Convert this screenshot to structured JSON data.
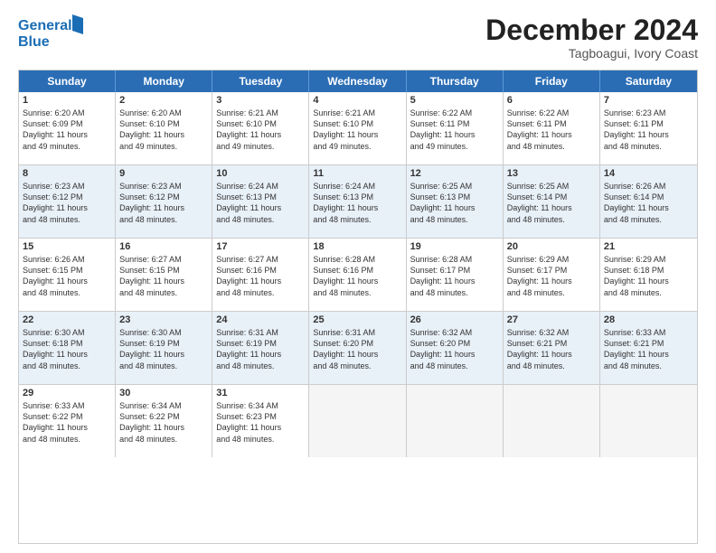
{
  "header": {
    "logo_line1": "General",
    "logo_line2": "Blue",
    "month_title": "December 2024",
    "location": "Tagboagui, Ivory Coast"
  },
  "weekdays": [
    "Sunday",
    "Monday",
    "Tuesday",
    "Wednesday",
    "Thursday",
    "Friday",
    "Saturday"
  ],
  "rows": [
    [
      {
        "day": "1",
        "lines": [
          "Sunrise: 6:20 AM",
          "Sunset: 6:09 PM",
          "Daylight: 11 hours",
          "and 49 minutes."
        ]
      },
      {
        "day": "2",
        "lines": [
          "Sunrise: 6:20 AM",
          "Sunset: 6:10 PM",
          "Daylight: 11 hours",
          "and 49 minutes."
        ]
      },
      {
        "day": "3",
        "lines": [
          "Sunrise: 6:21 AM",
          "Sunset: 6:10 PM",
          "Daylight: 11 hours",
          "and 49 minutes."
        ]
      },
      {
        "day": "4",
        "lines": [
          "Sunrise: 6:21 AM",
          "Sunset: 6:10 PM",
          "Daylight: 11 hours",
          "and 49 minutes."
        ]
      },
      {
        "day": "5",
        "lines": [
          "Sunrise: 6:22 AM",
          "Sunset: 6:11 PM",
          "Daylight: 11 hours",
          "and 49 minutes."
        ]
      },
      {
        "day": "6",
        "lines": [
          "Sunrise: 6:22 AM",
          "Sunset: 6:11 PM",
          "Daylight: 11 hours",
          "and 48 minutes."
        ]
      },
      {
        "day": "7",
        "lines": [
          "Sunrise: 6:23 AM",
          "Sunset: 6:11 PM",
          "Daylight: 11 hours",
          "and 48 minutes."
        ]
      }
    ],
    [
      {
        "day": "8",
        "lines": [
          "Sunrise: 6:23 AM",
          "Sunset: 6:12 PM",
          "Daylight: 11 hours",
          "and 48 minutes."
        ]
      },
      {
        "day": "9",
        "lines": [
          "Sunrise: 6:23 AM",
          "Sunset: 6:12 PM",
          "Daylight: 11 hours",
          "and 48 minutes."
        ]
      },
      {
        "day": "10",
        "lines": [
          "Sunrise: 6:24 AM",
          "Sunset: 6:13 PM",
          "Daylight: 11 hours",
          "and 48 minutes."
        ]
      },
      {
        "day": "11",
        "lines": [
          "Sunrise: 6:24 AM",
          "Sunset: 6:13 PM",
          "Daylight: 11 hours",
          "and 48 minutes."
        ]
      },
      {
        "day": "12",
        "lines": [
          "Sunrise: 6:25 AM",
          "Sunset: 6:13 PM",
          "Daylight: 11 hours",
          "and 48 minutes."
        ]
      },
      {
        "day": "13",
        "lines": [
          "Sunrise: 6:25 AM",
          "Sunset: 6:14 PM",
          "Daylight: 11 hours",
          "and 48 minutes."
        ]
      },
      {
        "day": "14",
        "lines": [
          "Sunrise: 6:26 AM",
          "Sunset: 6:14 PM",
          "Daylight: 11 hours",
          "and 48 minutes."
        ]
      }
    ],
    [
      {
        "day": "15",
        "lines": [
          "Sunrise: 6:26 AM",
          "Sunset: 6:15 PM",
          "Daylight: 11 hours",
          "and 48 minutes."
        ]
      },
      {
        "day": "16",
        "lines": [
          "Sunrise: 6:27 AM",
          "Sunset: 6:15 PM",
          "Daylight: 11 hours",
          "and 48 minutes."
        ]
      },
      {
        "day": "17",
        "lines": [
          "Sunrise: 6:27 AM",
          "Sunset: 6:16 PM",
          "Daylight: 11 hours",
          "and 48 minutes."
        ]
      },
      {
        "day": "18",
        "lines": [
          "Sunrise: 6:28 AM",
          "Sunset: 6:16 PM",
          "Daylight: 11 hours",
          "and 48 minutes."
        ]
      },
      {
        "day": "19",
        "lines": [
          "Sunrise: 6:28 AM",
          "Sunset: 6:17 PM",
          "Daylight: 11 hours",
          "and 48 minutes."
        ]
      },
      {
        "day": "20",
        "lines": [
          "Sunrise: 6:29 AM",
          "Sunset: 6:17 PM",
          "Daylight: 11 hours",
          "and 48 minutes."
        ]
      },
      {
        "day": "21",
        "lines": [
          "Sunrise: 6:29 AM",
          "Sunset: 6:18 PM",
          "Daylight: 11 hours",
          "and 48 minutes."
        ]
      }
    ],
    [
      {
        "day": "22",
        "lines": [
          "Sunrise: 6:30 AM",
          "Sunset: 6:18 PM",
          "Daylight: 11 hours",
          "and 48 minutes."
        ]
      },
      {
        "day": "23",
        "lines": [
          "Sunrise: 6:30 AM",
          "Sunset: 6:19 PM",
          "Daylight: 11 hours",
          "and 48 minutes."
        ]
      },
      {
        "day": "24",
        "lines": [
          "Sunrise: 6:31 AM",
          "Sunset: 6:19 PM",
          "Daylight: 11 hours",
          "and 48 minutes."
        ]
      },
      {
        "day": "25",
        "lines": [
          "Sunrise: 6:31 AM",
          "Sunset: 6:20 PM",
          "Daylight: 11 hours",
          "and 48 minutes."
        ]
      },
      {
        "day": "26",
        "lines": [
          "Sunrise: 6:32 AM",
          "Sunset: 6:20 PM",
          "Daylight: 11 hours",
          "and 48 minutes."
        ]
      },
      {
        "day": "27",
        "lines": [
          "Sunrise: 6:32 AM",
          "Sunset: 6:21 PM",
          "Daylight: 11 hours",
          "and 48 minutes."
        ]
      },
      {
        "day": "28",
        "lines": [
          "Sunrise: 6:33 AM",
          "Sunset: 6:21 PM",
          "Daylight: 11 hours",
          "and 48 minutes."
        ]
      }
    ],
    [
      {
        "day": "29",
        "lines": [
          "Sunrise: 6:33 AM",
          "Sunset: 6:22 PM",
          "Daylight: 11 hours",
          "and 48 minutes."
        ]
      },
      {
        "day": "30",
        "lines": [
          "Sunrise: 6:34 AM",
          "Sunset: 6:22 PM",
          "Daylight: 11 hours",
          "and 48 minutes."
        ]
      },
      {
        "day": "31",
        "lines": [
          "Sunrise: 6:34 AM",
          "Sunset: 6:23 PM",
          "Daylight: 11 hours",
          "and 48 minutes."
        ]
      },
      {
        "day": "",
        "lines": []
      },
      {
        "day": "",
        "lines": []
      },
      {
        "day": "",
        "lines": []
      },
      {
        "day": "",
        "lines": []
      }
    ]
  ]
}
